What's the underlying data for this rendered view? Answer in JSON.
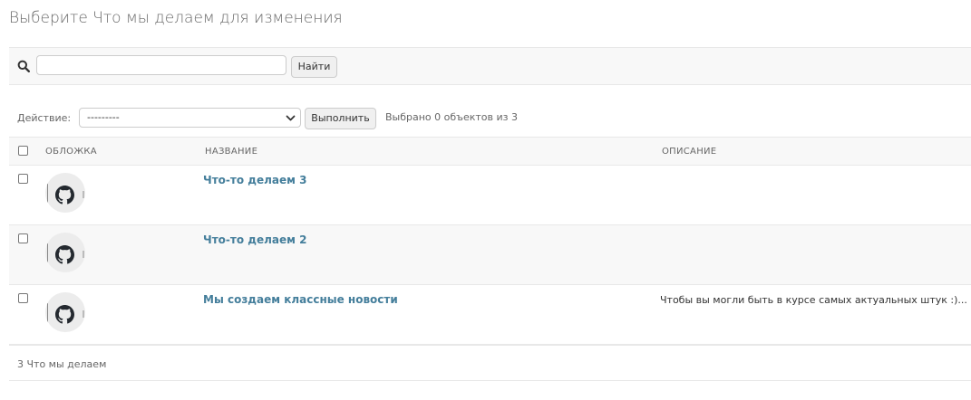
{
  "page": {
    "title": "Выберите Что мы делаем для изменения"
  },
  "search": {
    "value": "",
    "placeholder": "",
    "button_label": "Найти"
  },
  "actions": {
    "label": "Действие:",
    "selected_option": "---------",
    "run_label": "Выполнить",
    "counter": "Выбрано 0 объектов из 3"
  },
  "table": {
    "columns": [
      "ОБЛОЖКА",
      "НАЗВАНИЕ",
      "ОПИСАНИЕ"
    ],
    "rows": [
      {
        "cover_icon": "github-icon",
        "title": "Что-то делаем 3",
        "description": ""
      },
      {
        "cover_icon": "github-icon",
        "title": "Что-то делаем 2",
        "description": ""
      },
      {
        "cover_icon": "github-icon",
        "title": "Мы создаем классные новости",
        "description": "Чтобы вы могли быть в курсе самых актуальных штук :)..."
      }
    ]
  },
  "footer": {
    "count_text": "3 Что мы делаем"
  },
  "colors": {
    "link": "#447e9b",
    "toolbar_bg": "#f8f8f8",
    "border": "#e8e8e8"
  }
}
